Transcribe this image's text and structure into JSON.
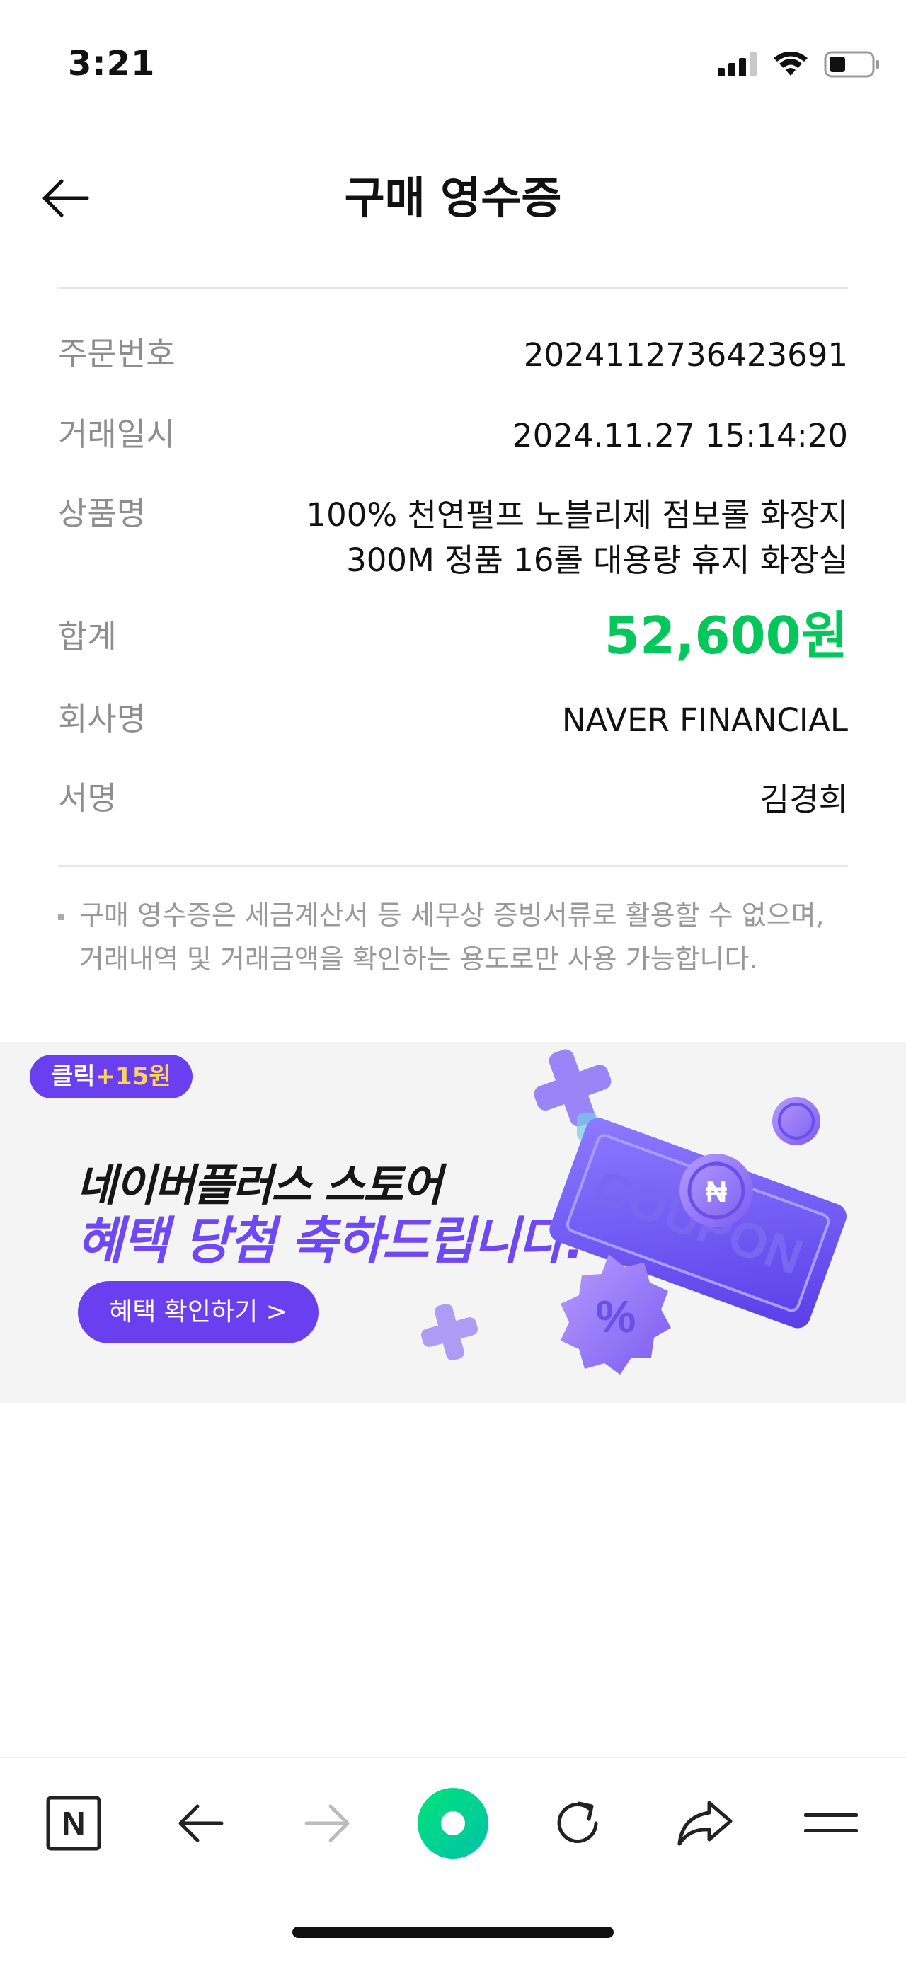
{
  "status": {
    "time": "3:21"
  },
  "header": {
    "title": "구매 영수증"
  },
  "receipt": [
    {
      "label": "주문번호",
      "value": "2024112736423691"
    },
    {
      "label": "거래일시",
      "value": "2024.11.27 15:14:20"
    },
    {
      "label": "상품명",
      "value": "100% 천연펄프 노블리제 점보롤 화장지 300M 정품 16롤 대용량 휴지 화장실"
    },
    {
      "label": "합계",
      "value": "52,600원"
    },
    {
      "label": "회사명",
      "value": "NAVER FINANCIAL"
    },
    {
      "label": "서명",
      "value": "김경희"
    }
  ],
  "notice": "구매 영수증은 세금계산서 등 세무상 증빙서류로 활용할 수 없으며, 거래내역 및 거래금액을 확인하는 용도로만 사용 가능합니다.",
  "banner": {
    "badge_prefix": "클릭",
    "badge_reward": "+15원",
    "line1": "네이버플러스 스토어",
    "line2": "혜택 당첨 축하드립니다!",
    "cta": "혜택 확인하기 >",
    "coupon_text": "COUPON",
    "percent_text": "%",
    "coin_text": "₦"
  },
  "toolbar": {
    "naver_letter": "N",
    "icons": [
      "naver-home-icon",
      "back-arrow-icon",
      "forward-arrow-icon",
      "green-dot-icon",
      "refresh-icon",
      "share-icon",
      "menu-icon"
    ]
  },
  "colors": {
    "accent_green": "#03c75a",
    "banner_purple": "#6a3ff0",
    "label_gray": "#8e8e8e"
  }
}
